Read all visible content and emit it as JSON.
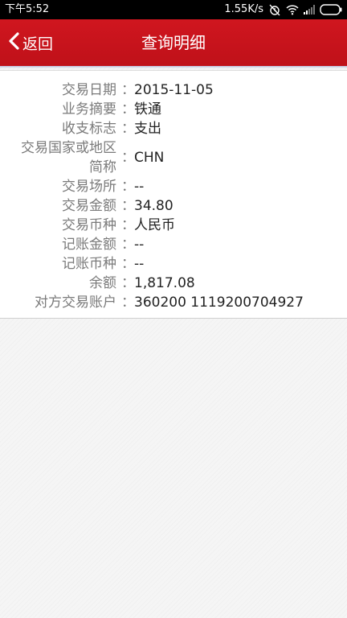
{
  "status_bar": {
    "time": "下午5:52",
    "net_speed": "1.55K/s"
  },
  "header": {
    "back_label": "返回",
    "title": "查询明细",
    "color": "#c8141c"
  },
  "details": [
    {
      "label": "交易日期",
      "value": "2015-11-05"
    },
    {
      "label": "业务摘要",
      "value": "铁通"
    },
    {
      "label": "收支标志",
      "value": "支出"
    },
    {
      "label_line1": "交易国家或地区",
      "label_line2": "简称",
      "value": "CHN"
    },
    {
      "label": "交易场所",
      "value": "--"
    },
    {
      "label": "交易金额",
      "value": "34.80"
    },
    {
      "label": "交易币种",
      "value": "人民币"
    },
    {
      "label": "记账金额",
      "value": "--"
    },
    {
      "label": "记账币种",
      "value": "--"
    },
    {
      "label": "余额",
      "value": "1,817.08"
    },
    {
      "label": "对方交易账户",
      "value": "360200 1119200704927"
    }
  ],
  "colon": "："
}
